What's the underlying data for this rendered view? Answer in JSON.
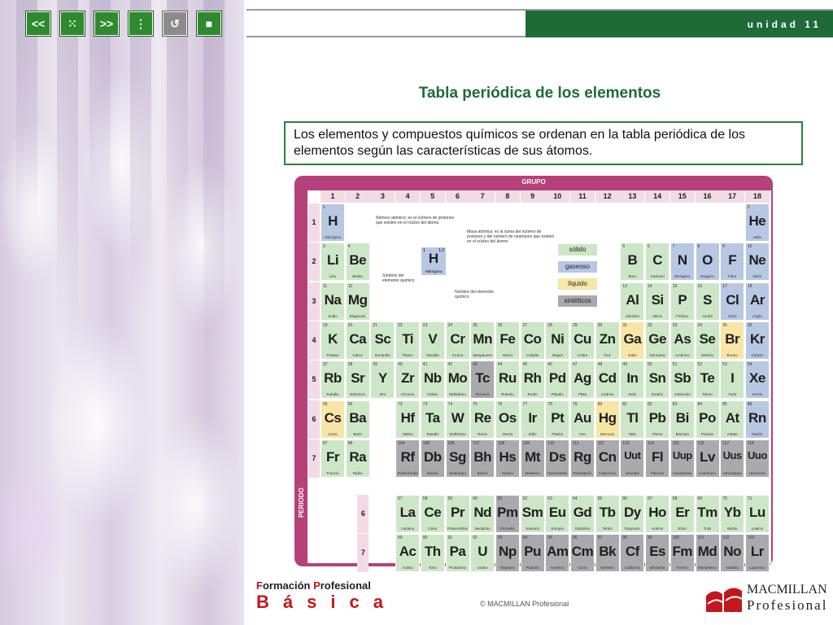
{
  "toolbar": {
    "prev": "<<",
    "menu": "⁙",
    "next": ">>",
    "index": "⋮",
    "back": "↺",
    "stop": "■"
  },
  "header": {
    "unit": "unidad 11"
  },
  "main": {
    "title": "Tabla periódica de los elementos",
    "intro": "Los elementos y compuestos químicos se ordenan en la tabla periódica de los elementos según las características de sus átomos."
  },
  "table": {
    "grupo_label": "GRUPO",
    "periodo_label": "PERIODO",
    "groups": [
      "1",
      "2",
      "3",
      "4",
      "5",
      "6",
      "7",
      "8",
      "9",
      "10",
      "11",
      "12",
      "13",
      "14",
      "15",
      "16",
      "17",
      "18"
    ],
    "periods": [
      "1",
      "2",
      "3",
      "4",
      "5",
      "6",
      "7"
    ],
    "legend": {
      "solid": "sólido",
      "gas": "gaseoso",
      "liquid": "líquido",
      "synth": "sintéticos"
    },
    "notes": {
      "atomic_number": "Número atómico: es el número de protones que existen en el núcleo del átomo.",
      "atomic_mass": "Masa atómica: es la suma del número de protones y del número de neutrones que existen en el núcleo del átomo.",
      "symbol": "Símbolo del elemento químico",
      "name": "Nombre del elemento químico"
    },
    "demo": {
      "z": "1",
      "m": "1,0",
      "s": "H",
      "n": "Hidrógeno"
    },
    "colors": {
      "solid": "#cde6c7",
      "gas": "#b8c7e2",
      "liquid": "#f7e6a6",
      "synth": "#a9a9ae",
      "frame": "#b5407a"
    },
    "elements": [
      {
        "z": "1",
        "s": "H",
        "n": "Hidrógeno",
        "g": 1,
        "p": 1,
        "t": "gas"
      },
      {
        "z": "2",
        "s": "He",
        "n": "Helio",
        "g": 18,
        "p": 1,
        "t": "gas"
      },
      {
        "z": "3",
        "s": "Li",
        "n": "Litio",
        "g": 1,
        "p": 2,
        "t": "solid"
      },
      {
        "z": "4",
        "s": "Be",
        "n": "Berilio",
        "g": 2,
        "p": 2,
        "t": "solid"
      },
      {
        "z": "5",
        "s": "B",
        "n": "Boro",
        "g": 13,
        "p": 2,
        "t": "solid"
      },
      {
        "z": "6",
        "s": "C",
        "n": "Carbono",
        "g": 14,
        "p": 2,
        "t": "solid"
      },
      {
        "z": "7",
        "s": "N",
        "n": "Nitrógeno",
        "g": 15,
        "p": 2,
        "t": "gas"
      },
      {
        "z": "8",
        "s": "O",
        "n": "Oxígeno",
        "g": 16,
        "p": 2,
        "t": "gas"
      },
      {
        "z": "9",
        "s": "F",
        "n": "Flúor",
        "g": 17,
        "p": 2,
        "t": "gas"
      },
      {
        "z": "10",
        "s": "Ne",
        "n": "Neón",
        "g": 18,
        "p": 2,
        "t": "gas"
      },
      {
        "z": "11",
        "s": "Na",
        "n": "Sodio",
        "g": 1,
        "p": 3,
        "t": "solid"
      },
      {
        "z": "12",
        "s": "Mg",
        "n": "Magnesio",
        "g": 2,
        "p": 3,
        "t": "solid"
      },
      {
        "z": "13",
        "s": "Al",
        "n": "Aluminio",
        "g": 13,
        "p": 3,
        "t": "solid"
      },
      {
        "z": "14",
        "s": "Si",
        "n": "Silicio",
        "g": 14,
        "p": 3,
        "t": "solid"
      },
      {
        "z": "15",
        "s": "P",
        "n": "Fósforo",
        "g": 15,
        "p": 3,
        "t": "solid"
      },
      {
        "z": "16",
        "s": "S",
        "n": "Azufre",
        "g": 16,
        "p": 3,
        "t": "solid"
      },
      {
        "z": "17",
        "s": "Cl",
        "n": "Cloro",
        "g": 17,
        "p": 3,
        "t": "gas"
      },
      {
        "z": "18",
        "s": "Ar",
        "n": "Argón",
        "g": 18,
        "p": 3,
        "t": "gas"
      },
      {
        "z": "19",
        "s": "K",
        "n": "Potasio",
        "g": 1,
        "p": 4,
        "t": "solid"
      },
      {
        "z": "20",
        "s": "Ca",
        "n": "Calcio",
        "g": 2,
        "p": 4,
        "t": "solid"
      },
      {
        "z": "21",
        "s": "Sc",
        "n": "Escandio",
        "g": 3,
        "p": 4,
        "t": "solid"
      },
      {
        "z": "22",
        "s": "Ti",
        "n": "Titanio",
        "g": 4,
        "p": 4,
        "t": "solid"
      },
      {
        "z": "23",
        "s": "V",
        "n": "Vanadio",
        "g": 5,
        "p": 4,
        "t": "solid"
      },
      {
        "z": "24",
        "s": "Cr",
        "n": "Cromo",
        "g": 6,
        "p": 4,
        "t": "solid"
      },
      {
        "z": "25",
        "s": "Mn",
        "n": "Manganeso",
        "g": 7,
        "p": 4,
        "t": "solid"
      },
      {
        "z": "26",
        "s": "Fe",
        "n": "Hierro",
        "g": 8,
        "p": 4,
        "t": "solid"
      },
      {
        "z": "27",
        "s": "Co",
        "n": "Cobalto",
        "g": 9,
        "p": 4,
        "t": "solid"
      },
      {
        "z": "28",
        "s": "Ni",
        "n": "Níquel",
        "g": 10,
        "p": 4,
        "t": "solid"
      },
      {
        "z": "29",
        "s": "Cu",
        "n": "Cobre",
        "g": 11,
        "p": 4,
        "t": "solid"
      },
      {
        "z": "30",
        "s": "Zn",
        "n": "Cinc",
        "g": 12,
        "p": 4,
        "t": "solid"
      },
      {
        "z": "31",
        "s": "Ga",
        "n": "Galio",
        "g": 13,
        "p": 4,
        "t": "liquid"
      },
      {
        "z": "32",
        "s": "Ge",
        "n": "Germanio",
        "g": 14,
        "p": 4,
        "t": "solid"
      },
      {
        "z": "33",
        "s": "As",
        "n": "Arsénico",
        "g": 15,
        "p": 4,
        "t": "solid"
      },
      {
        "z": "34",
        "s": "Se",
        "n": "Selenio",
        "g": 16,
        "p": 4,
        "t": "solid"
      },
      {
        "z": "35",
        "s": "Br",
        "n": "Bromo",
        "g": 17,
        "p": 4,
        "t": "liquid"
      },
      {
        "z": "36",
        "s": "Kr",
        "n": "Criptón",
        "g": 18,
        "p": 4,
        "t": "gas"
      },
      {
        "z": "37",
        "s": "Rb",
        "n": "Rubidio",
        "g": 1,
        "p": 5,
        "t": "solid"
      },
      {
        "z": "38",
        "s": "Sr",
        "n": "Estroncio",
        "g": 2,
        "p": 5,
        "t": "solid"
      },
      {
        "z": "39",
        "s": "Y",
        "n": "Itrio",
        "g": 3,
        "p": 5,
        "t": "solid"
      },
      {
        "z": "40",
        "s": "Zr",
        "n": "Circonio",
        "g": 4,
        "p": 5,
        "t": "solid"
      },
      {
        "z": "41",
        "s": "Nb",
        "n": "Niobio",
        "g": 5,
        "p": 5,
        "t": "solid"
      },
      {
        "z": "42",
        "s": "Mo",
        "n": "Molibdeno",
        "g": 6,
        "p": 5,
        "t": "solid"
      },
      {
        "z": "43",
        "s": "Tc",
        "n": "Tecnecio",
        "g": 7,
        "p": 5,
        "t": "synth"
      },
      {
        "z": "44",
        "s": "Ru",
        "n": "Rutenio",
        "g": 8,
        "p": 5,
        "t": "solid"
      },
      {
        "z": "45",
        "s": "Rh",
        "n": "Rodio",
        "g": 9,
        "p": 5,
        "t": "solid"
      },
      {
        "z": "46",
        "s": "Pd",
        "n": "Paladio",
        "g": 10,
        "p": 5,
        "t": "solid"
      },
      {
        "z": "47",
        "s": "Ag",
        "n": "Plata",
        "g": 11,
        "p": 5,
        "t": "solid"
      },
      {
        "z": "48",
        "s": "Cd",
        "n": "Cadmio",
        "g": 12,
        "p": 5,
        "t": "solid"
      },
      {
        "z": "49",
        "s": "In",
        "n": "Indio",
        "g": 13,
        "p": 5,
        "t": "solid"
      },
      {
        "z": "50",
        "s": "Sn",
        "n": "Estaño",
        "g": 14,
        "p": 5,
        "t": "solid"
      },
      {
        "z": "51",
        "s": "Sb",
        "n": "Antimonio",
        "g": 15,
        "p": 5,
        "t": "solid"
      },
      {
        "z": "52",
        "s": "Te",
        "n": "Teluro",
        "g": 16,
        "p": 5,
        "t": "solid"
      },
      {
        "z": "53",
        "s": "I",
        "n": "Yodo",
        "g": 17,
        "p": 5,
        "t": "solid"
      },
      {
        "z": "54",
        "s": "Xe",
        "n": "Xenón",
        "g": 18,
        "p": 5,
        "t": "gas"
      },
      {
        "z": "55",
        "s": "Cs",
        "n": "Cesio",
        "g": 1,
        "p": 6,
        "t": "liquid"
      },
      {
        "z": "56",
        "s": "Ba",
        "n": "Bario",
        "g": 2,
        "p": 6,
        "t": "solid"
      },
      {
        "z": "72",
        "s": "Hf",
        "n": "Hafnio",
        "g": 4,
        "p": 6,
        "t": "solid"
      },
      {
        "z": "73",
        "s": "Ta",
        "n": "Tantalio",
        "g": 5,
        "p": 6,
        "t": "solid"
      },
      {
        "z": "74",
        "s": "W",
        "n": "Wolframio",
        "g": 6,
        "p": 6,
        "t": "solid"
      },
      {
        "z": "75",
        "s": "Re",
        "n": "Renio",
        "g": 7,
        "p": 6,
        "t": "solid"
      },
      {
        "z": "76",
        "s": "Os",
        "n": "Osmio",
        "g": 8,
        "p": 6,
        "t": "solid"
      },
      {
        "z": "77",
        "s": "Ir",
        "n": "Iridio",
        "g": 9,
        "p": 6,
        "t": "solid"
      },
      {
        "z": "78",
        "s": "Pt",
        "n": "Platino",
        "g": 10,
        "p": 6,
        "t": "solid"
      },
      {
        "z": "79",
        "s": "Au",
        "n": "Oro",
        "g": 11,
        "p": 6,
        "t": "solid"
      },
      {
        "z": "80",
        "s": "Hg",
        "n": "Mercurio",
        "g": 12,
        "p": 6,
        "t": "liquid"
      },
      {
        "z": "81",
        "s": "Tl",
        "n": "Talio",
        "g": 13,
        "p": 6,
        "t": "solid"
      },
      {
        "z": "82",
        "s": "Pb",
        "n": "Plomo",
        "g": 14,
        "p": 6,
        "t": "solid"
      },
      {
        "z": "83",
        "s": "Bi",
        "n": "Bismuto",
        "g": 15,
        "p": 6,
        "t": "solid"
      },
      {
        "z": "84",
        "s": "Po",
        "n": "Polonio",
        "g": 16,
        "p": 6,
        "t": "solid"
      },
      {
        "z": "85",
        "s": "At",
        "n": "Astato",
        "g": 17,
        "p": 6,
        "t": "solid"
      },
      {
        "z": "86",
        "s": "Rn",
        "n": "Radón",
        "g": 18,
        "p": 6,
        "t": "gas"
      },
      {
        "z": "87",
        "s": "Fr",
        "n": "Francio",
        "g": 1,
        "p": 7,
        "t": "solid"
      },
      {
        "z": "88",
        "s": "Ra",
        "n": "Radio",
        "g": 2,
        "p": 7,
        "t": "solid"
      },
      {
        "z": "104",
        "s": "Rf",
        "n": "Rutherfordio",
        "g": 4,
        "p": 7,
        "t": "synth"
      },
      {
        "z": "105",
        "s": "Db",
        "n": "Dubnio",
        "g": 5,
        "p": 7,
        "t": "synth"
      },
      {
        "z": "106",
        "s": "Sg",
        "n": "Seaborgio",
        "g": 6,
        "p": 7,
        "t": "synth"
      },
      {
        "z": "107",
        "s": "Bh",
        "n": "Bohrio",
        "g": 7,
        "p": 7,
        "t": "synth"
      },
      {
        "z": "108",
        "s": "Hs",
        "n": "Hassio",
        "g": 8,
        "p": 7,
        "t": "synth"
      },
      {
        "z": "109",
        "s": "Mt",
        "n": "Meitnerio",
        "g": 9,
        "p": 7,
        "t": "synth"
      },
      {
        "z": "110",
        "s": "Ds",
        "n": "Darmstadtio",
        "g": 10,
        "p": 7,
        "t": "synth"
      },
      {
        "z": "111",
        "s": "Rg",
        "n": "Roentgenio",
        "g": 11,
        "p": 7,
        "t": "synth"
      },
      {
        "z": "112",
        "s": "Cn",
        "n": "Copernicio",
        "g": 12,
        "p": 7,
        "t": "synth"
      },
      {
        "z": "113",
        "s": "Uut",
        "n": "Ununtrio",
        "g": 13,
        "p": 7,
        "t": "synth"
      },
      {
        "z": "114",
        "s": "Fl",
        "n": "Flerovio",
        "g": 14,
        "p": 7,
        "t": "synth"
      },
      {
        "z": "115",
        "s": "Uup",
        "n": "Ununpentio",
        "g": 15,
        "p": 7,
        "t": "synth"
      },
      {
        "z": "116",
        "s": "Lv",
        "n": "Livermorio",
        "g": 16,
        "p": 7,
        "t": "synth"
      },
      {
        "z": "117",
        "s": "Uus",
        "n": "Ununseptio",
        "g": 17,
        "p": 7,
        "t": "synth"
      },
      {
        "z": "118",
        "s": "Uuo",
        "n": "Ununoctio",
        "g": 18,
        "p": 7,
        "t": "synth"
      }
    ],
    "lanthanides": [
      {
        "z": "57",
        "s": "La",
        "n": "Lantano",
        "t": "solid"
      },
      {
        "z": "58",
        "s": "Ce",
        "n": "Cerio",
        "t": "solid"
      },
      {
        "z": "59",
        "s": "Pr",
        "n": "Praseodimio",
        "t": "solid"
      },
      {
        "z": "60",
        "s": "Nd",
        "n": "Neodimio",
        "t": "solid"
      },
      {
        "z": "61",
        "s": "Pm",
        "n": "Prometio",
        "t": "synth"
      },
      {
        "z": "62",
        "s": "Sm",
        "n": "Samario",
        "t": "solid"
      },
      {
        "z": "63",
        "s": "Eu",
        "n": "Europio",
        "t": "solid"
      },
      {
        "z": "64",
        "s": "Gd",
        "n": "Gadolinio",
        "t": "solid"
      },
      {
        "z": "65",
        "s": "Tb",
        "n": "Terbio",
        "t": "solid"
      },
      {
        "z": "66",
        "s": "Dy",
        "n": "Disprosio",
        "t": "solid"
      },
      {
        "z": "67",
        "s": "Ho",
        "n": "Holmio",
        "t": "solid"
      },
      {
        "z": "68",
        "s": "Er",
        "n": "Erbio",
        "t": "solid"
      },
      {
        "z": "69",
        "s": "Tm",
        "n": "Tulio",
        "t": "solid"
      },
      {
        "z": "70",
        "s": "Yb",
        "n": "Iterbio",
        "t": "solid"
      },
      {
        "z": "71",
        "s": "Lu",
        "n": "Lutecio",
        "t": "solid"
      }
    ],
    "actinides": [
      {
        "z": "89",
        "s": "Ac",
        "n": "Actinio",
        "t": "solid"
      },
      {
        "z": "90",
        "s": "Th",
        "n": "Torio",
        "t": "solid"
      },
      {
        "z": "91",
        "s": "Pa",
        "n": "Protactinio",
        "t": "solid"
      },
      {
        "z": "92",
        "s": "U",
        "n": "Uranio",
        "t": "solid"
      },
      {
        "z": "93",
        "s": "Np",
        "n": "Neptunio",
        "t": "synth"
      },
      {
        "z": "94",
        "s": "Pu",
        "n": "Plutonio",
        "t": "synth"
      },
      {
        "z": "95",
        "s": "Am",
        "n": "Americio",
        "t": "synth"
      },
      {
        "z": "96",
        "s": "Cm",
        "n": "Curio",
        "t": "synth"
      },
      {
        "z": "97",
        "s": "Bk",
        "n": "Berkelio",
        "t": "synth"
      },
      {
        "z": "98",
        "s": "Cf",
        "n": "Californio",
        "t": "synth"
      },
      {
        "z": "99",
        "s": "Es",
        "n": "Einstenio",
        "t": "synth"
      },
      {
        "z": "100",
        "s": "Fm",
        "n": "Fermio",
        "t": "synth"
      },
      {
        "z": "101",
        "s": "Md",
        "n": "Mendelevio",
        "t": "synth"
      },
      {
        "z": "102",
        "s": "No",
        "n": "Nobelio",
        "t": "synth"
      },
      {
        "z": "103",
        "s": "Lr",
        "n": "Laurencio",
        "t": "synth"
      }
    ],
    "series_labels": [
      "6",
      "7"
    ]
  },
  "footer": {
    "brand_line1_a": "F",
    "brand_line1_b": "ormación ",
    "brand_line1_c": "P",
    "brand_line1_d": "rofesional",
    "brand_line2": "Básica",
    "copyright": "© MACMILLAN Profesional",
    "publisher1": "MACMILLAN",
    "publisher2": "Profesional"
  }
}
